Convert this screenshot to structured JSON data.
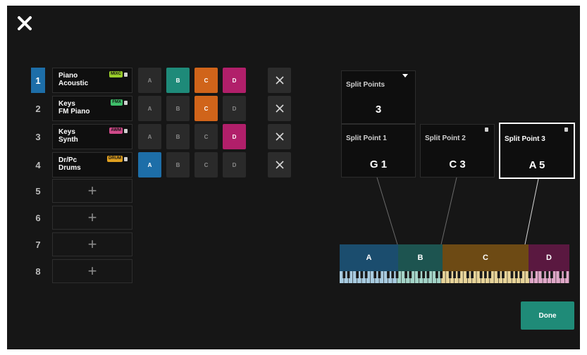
{
  "header": {
    "close_icon": "close-icon"
  },
  "parts": [
    {
      "number": "1",
      "line1": "Piano",
      "line2": "Acoustic",
      "badge": "MIXC",
      "badge_color": "#9acd2a",
      "active": true,
      "zones": [
        "A",
        "B",
        "C",
        "D"
      ],
      "zone_on": [
        false,
        true,
        true,
        true
      ]
    },
    {
      "number": "2",
      "line1": "Keys",
      "line2": "FM Piano",
      "badge": "FMX",
      "badge_color": "#3fbf6a",
      "active": false,
      "zones": [
        "A",
        "B",
        "C",
        "D"
      ],
      "zone_on": [
        false,
        false,
        true,
        false
      ]
    },
    {
      "number": "3",
      "line1": "Keys",
      "line2": "Synth",
      "badge": "AWM",
      "badge_color": "#d04a8a",
      "active": false,
      "zones": [
        "A",
        "B",
        "C",
        "D"
      ],
      "zone_on": [
        false,
        false,
        false,
        true
      ]
    },
    {
      "number": "4",
      "line1": "Dr/Pc",
      "line2": "Drums",
      "badge": "DRUM",
      "badge_color": "#e0a020",
      "active": false,
      "zones": [
        "A",
        "B",
        "C",
        "D"
      ],
      "zone_on": [
        true,
        false,
        false,
        false
      ]
    }
  ],
  "empty_parts": [
    "5",
    "6",
    "7",
    "8"
  ],
  "zone_colors": {
    "A": "#1d6ea8",
    "B": "#1e8a79",
    "C": "#d0641a",
    "D": "#b11f6a"
  },
  "split_points": {
    "count_label": "Split Points",
    "count_value": "3",
    "points": [
      {
        "label": "Split Point 1",
        "value": "G 1"
      },
      {
        "label": "Split Point 2",
        "value": "C 3"
      },
      {
        "label": "Split Point 3",
        "value": "A 5"
      }
    ]
  },
  "keyboard_zones": [
    {
      "label": "A",
      "color": "#1b4d6e",
      "fraction": 0.255
    },
    {
      "label": "B",
      "color": "#1d5450",
      "fraction": 0.192
    },
    {
      "label": "C",
      "color": "#6d4a14",
      "fraction": 0.375
    },
    {
      "label": "D",
      "color": "#5a1840",
      "fraction": 0.178
    }
  ],
  "done_label": "Done"
}
